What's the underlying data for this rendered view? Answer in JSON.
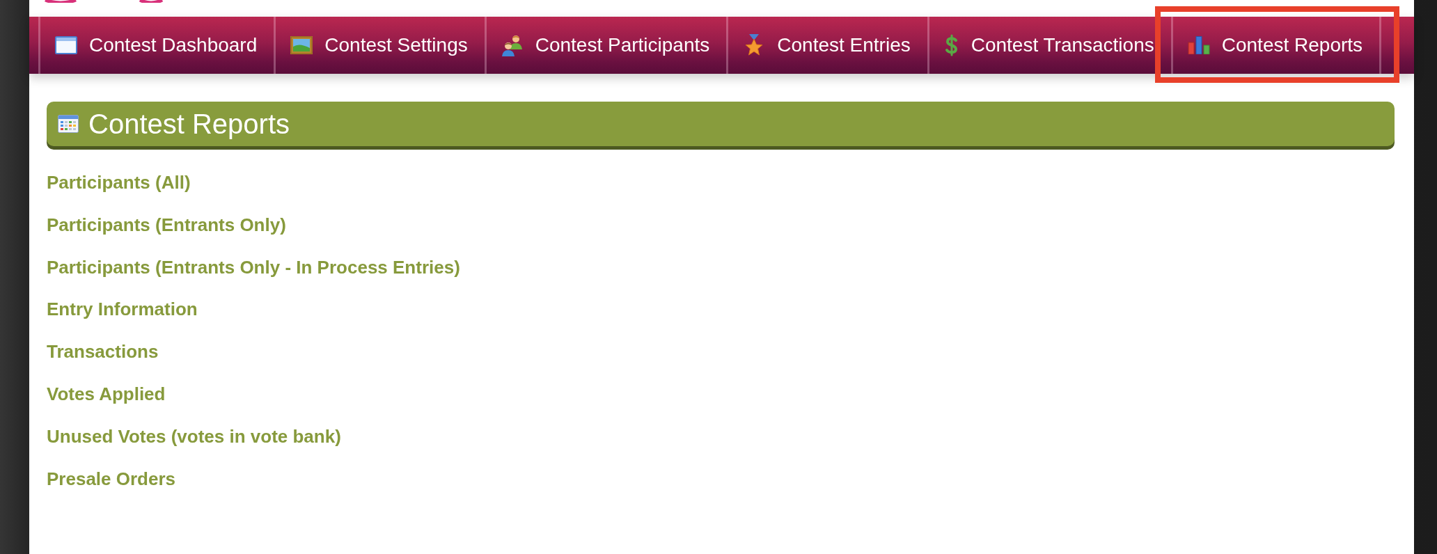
{
  "tabs": [
    {
      "label": "Contest Dashboard",
      "highlighted": false
    },
    {
      "label": "Contest Settings",
      "highlighted": false
    },
    {
      "label": "Contest Participants",
      "highlighted": false
    },
    {
      "label": "Contest Entries",
      "highlighted": false
    },
    {
      "label": "Contest Transactions",
      "highlighted": false
    },
    {
      "label": "Contest Reports",
      "highlighted": true
    }
  ],
  "panel": {
    "title": "Contest Reports"
  },
  "report_links": [
    "Participants (All)",
    "Participants (Entrants Only)",
    "Participants (Entrants Only - In Process Entries)",
    "Entry Information",
    "Transactions",
    "Votes Applied",
    "Unused Votes (votes in vote bank)",
    "Presale Orders"
  ]
}
